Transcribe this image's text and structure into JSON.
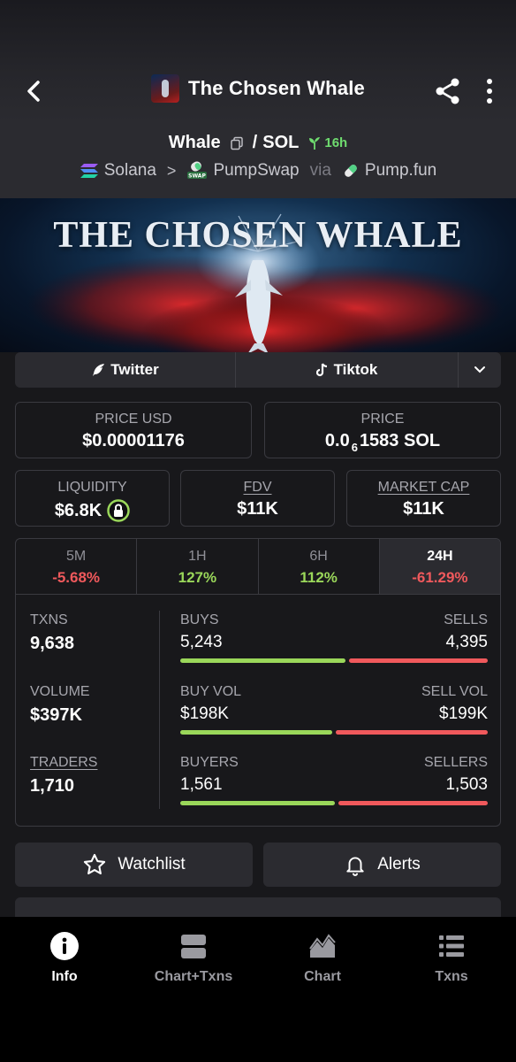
{
  "header": {
    "title": "The Chosen Whale"
  },
  "pair": {
    "base": "Whale",
    "separator": "/",
    "quote": "SOL",
    "age": "16h",
    "chain": "Solana",
    "dex": "PumpSwap",
    "via_label": "via",
    "launchpad": "Pump.fun"
  },
  "banner": {
    "title": "THE CHOSEN WHALE"
  },
  "social": {
    "twitter": "Twitter",
    "tiktok": "Tiktok"
  },
  "metrics": {
    "price_usd_label": "PRICE USD",
    "price_usd": "$0.00001176",
    "price_label": "PRICE",
    "price_prefix": "0.0",
    "price_sub": "6",
    "price_rest": "1583 SOL",
    "liquidity_label": "LIQUIDITY",
    "liquidity": "$6.8K",
    "fdv_label": "FDV",
    "fdv": "$11K",
    "mcap_label": "MARKET CAP",
    "mcap": "$11K"
  },
  "periods": [
    {
      "label": "5M",
      "change": "-5.68%"
    },
    {
      "label": "1H",
      "change": "127%"
    },
    {
      "label": "6H",
      "change": "112%"
    },
    {
      "label": "24H",
      "change": "-61.29%"
    }
  ],
  "stats": {
    "txns_label": "TXNS",
    "txns": "9,638",
    "volume_label": "VOLUME",
    "volume": "$397K",
    "traders_label": "TRADERS",
    "traders": "1,710",
    "buys_label": "BUYS",
    "buys": "5,243",
    "sells_label": "SELLS",
    "sells": "4,395",
    "buys_fraction": 0.544,
    "buy_vol_label": "BUY VOL",
    "buy_vol": "$198K",
    "sell_vol_label": "SELL VOL",
    "sell_vol": "$199K",
    "buy_vol_fraction": 0.499,
    "buyers_label": "BUYERS",
    "buyers": "1,561",
    "sellers_label": "SELLERS",
    "sellers": "1,503",
    "buyers_fraction": 0.509
  },
  "actions": {
    "watchlist": "Watchlist",
    "alerts": "Alerts"
  },
  "nav": {
    "info": "Info",
    "chart_txns": "Chart+Txns",
    "chart": "Chart",
    "txns": "Txns"
  },
  "colors": {
    "positive": "#9ad75a",
    "negative": "#f0595c",
    "age_green": "#6fdc6f"
  }
}
